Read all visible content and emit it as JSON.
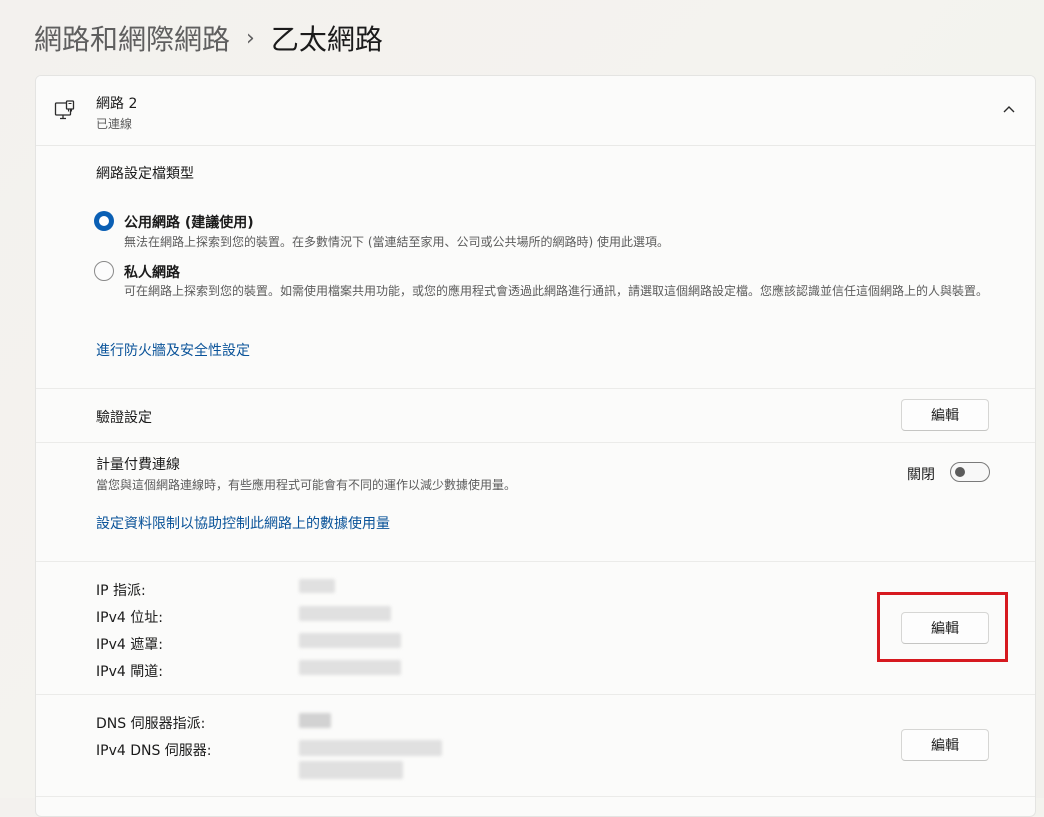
{
  "breadcrumb": {
    "parent": "網路和網際網路",
    "separator": "›",
    "current": "乙太網路"
  },
  "network": {
    "icon": "ethernet-monitor-icon",
    "name": "網路 2",
    "status": "已連線",
    "collapse_icon": "chevron-up-icon"
  },
  "profile": {
    "title": "網路設定檔類型",
    "selected": "公用網路 (建議使用)",
    "options": [
      {
        "label": "公用網路 (建議使用)",
        "desc": "無法在網路上探索到您的裝置。在多數情況下 (當連結至家用、公司或公共場所的網路時) 使用此選項。"
      },
      {
        "label": "私人網路",
        "desc": "可在網路上探索到您的裝置。如需使用檔案共用功能，或您的應用程式會透過此網路進行通訊，請選取這個網路設定檔。您應該認識並信任這個網路上的人與裝置。"
      }
    ],
    "firewall_link": "進行防火牆及安全性設定"
  },
  "auth": {
    "label": "驗證設定",
    "button": "編輯"
  },
  "metered": {
    "label": "計量付費連線",
    "desc": "當您與這個網路連線時，有些應用程式可能會有不同的運作以減少數據使用量。",
    "toggle_text": "關閉",
    "toggle_on": false,
    "link": "設定資料限制以協助控制此網路上的數據使用量"
  },
  "ip": {
    "labels": [
      "IP 指派:",
      "IPv4 位址:",
      "IPv4 遮罩:",
      "IPv4 閘道:"
    ],
    "button": "編輯"
  },
  "dns": {
    "labels": [
      "DNS 伺服器指派:",
      "IPv4 DNS 伺服器:"
    ],
    "button": "編輯"
  },
  "colors": {
    "accent": "#0a5fb4",
    "link": "#0a5399",
    "highlight_box": "#d6191f"
  }
}
